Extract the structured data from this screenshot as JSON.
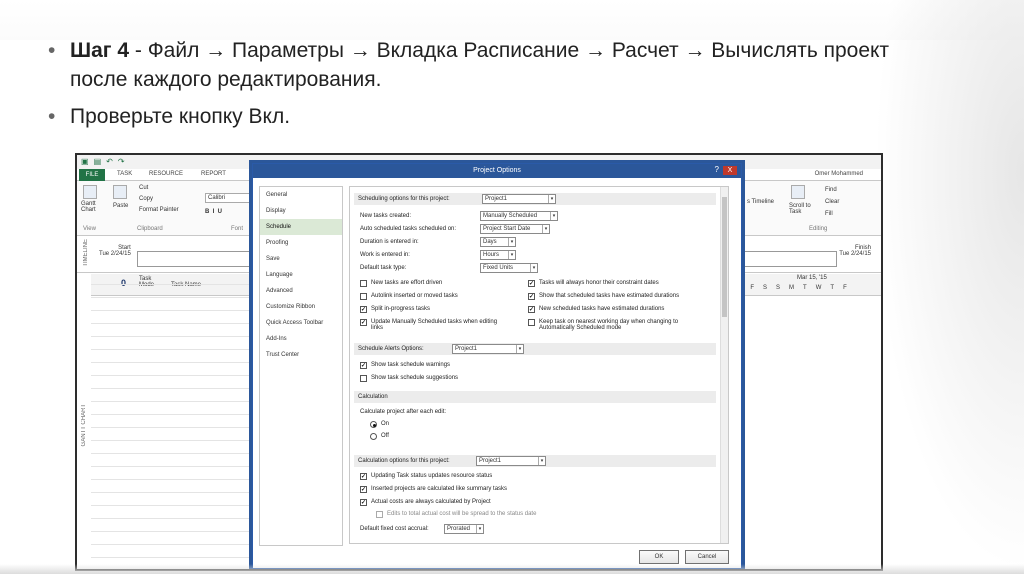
{
  "slide": {
    "bullets": [
      {
        "strong": "Шаг 4",
        "text": " - Файл → Параметры → Вкладка Расписание → Расчет → Вычислять проект после каждого редактирования."
      },
      {
        "strong": "",
        "text": "Проверьте кнопку Вкл."
      }
    ]
  },
  "app": {
    "user": "Omer Mohammed",
    "tabs": {
      "file": "FILE",
      "task": "TASK",
      "resource": "RESOURCE",
      "report": "REPORT"
    },
    "ribbon": {
      "gantt": "Gantt Chart",
      "paste": "Paste",
      "cut": "Cut",
      "copy": "Copy",
      "format_painter": "Format Painter",
      "font": "Calibri",
      "group_view": "View",
      "group_clipboard": "Clipboard",
      "group_font": "Font",
      "find": "Find",
      "clear": "Clear",
      "fill": "Fill",
      "scroll_to_task": "Scroll to Task",
      "timeline": "s Timeline",
      "group_editing": "Editing"
    },
    "timeline": {
      "label": "TIMELINE",
      "start_label": "Start",
      "start_date": "Tue 2/24/15",
      "finish_label": "Finish",
      "finish_date": "Tue 2/24/15"
    },
    "grid": {
      "side_label": "GANTT CHART",
      "col_info": "0",
      "col_mode": "Task Mode",
      "col_name": "Task Name",
      "week_label": "Mar 15, '15",
      "days": [
        "W",
        "T",
        "F",
        "S",
        "S",
        "M",
        "T",
        "W",
        "T",
        "F"
      ]
    }
  },
  "dialog": {
    "title": "Project Options",
    "help": "?",
    "close": "X",
    "nav": [
      "General",
      "Display",
      "Schedule",
      "Proofing",
      "Save",
      "Language",
      "Advanced",
      "Customize Ribbon",
      "Quick Access Toolbar",
      "Add-Ins",
      "Trust Center"
    ],
    "nav_active": "Schedule",
    "sched_header": "Scheduling options for this project:",
    "project": "Project1",
    "fields": [
      {
        "label": "New tasks created:",
        "value": "Manually Scheduled"
      },
      {
        "label": "Auto scheduled tasks scheduled on:",
        "value": "Project Start Date"
      },
      {
        "label": "Duration is entered in:",
        "value": "Days"
      },
      {
        "label": "Work is entered in:",
        "value": "Hours"
      },
      {
        "label": "Default task type:",
        "value": "Fixed Units"
      }
    ],
    "checks_left": [
      {
        "label": "New tasks are effort driven",
        "on": false
      },
      {
        "label": "Autolink inserted or moved tasks",
        "on": false
      },
      {
        "label": "Split in-progress tasks",
        "on": true
      },
      {
        "label": "Update Manually Scheduled tasks when editing links",
        "on": true
      }
    ],
    "checks_right": [
      {
        "label": "Tasks will always honor their constraint dates",
        "on": true
      },
      {
        "label": "Show that scheduled tasks have estimated durations",
        "on": true
      },
      {
        "label": "New scheduled tasks have estimated durations",
        "on": true
      },
      {
        "label": "Keep task on nearest working day when changing to Automatically Scheduled mode",
        "on": false
      }
    ],
    "alerts_header": "Schedule Alerts Options:",
    "alerts": [
      {
        "label": "Show task schedule warnings",
        "on": true
      },
      {
        "label": "Show task schedule suggestions",
        "on": false
      }
    ],
    "calc_header": "Calculation",
    "calc_question": "Calculate project after each edit:",
    "calc_on": "On",
    "calc_off": "Off",
    "calc_opts_header": "Calculation options for this project:",
    "calc_opts": [
      {
        "label": "Updating Task status updates resource status",
        "on": true
      },
      {
        "label": "Inserted projects are calculated like summary tasks",
        "on": true
      },
      {
        "label": "Actual costs are always calculated by Project",
        "on": true
      },
      {
        "label": "Edits to total actual cost will be spread to the status date",
        "on": false
      }
    ],
    "fixed_cost_label": "Default fixed cost accrual:",
    "fixed_cost_value": "Prorated",
    "ok": "OK",
    "cancel": "Cancel"
  }
}
